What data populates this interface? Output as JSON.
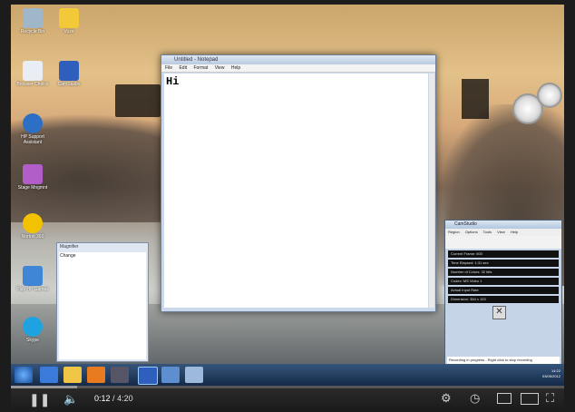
{
  "desktop": {
    "icons": [
      {
        "label": "Recycle Bin"
      },
      {
        "label": "Vuze"
      },
      {
        "label": "Browser Choice"
      },
      {
        "label": "CamStudio"
      },
      {
        "label": "HP Support Assistant"
      },
      {
        "label": "Stage Mngmnt"
      },
      {
        "label": "Norton 360"
      },
      {
        "label": "Play HP Games"
      },
      {
        "label": "Skype"
      }
    ]
  },
  "notepad": {
    "title": "Untitled - Notepad",
    "menu": [
      "File",
      "Edit",
      "Format",
      "View",
      "Help"
    ],
    "content": "Hi"
  },
  "mini_window": {
    "title": "Magnifier",
    "body": "Change"
  },
  "camstudio": {
    "title": "CamStudio",
    "menu": [
      "Region",
      "Options",
      "Tools",
      "View",
      "Help"
    ],
    "rows": [
      "Current Frame: 600",
      "Time Elapsed: 1:31 sec",
      "Number of Colors: 32 bits",
      "Codec: MS Video 1",
      "Actual Input Rate",
      "Dimension: 384 x 153"
    ],
    "status": "Recording in progress - Right click to stop recording"
  },
  "taskbar": {
    "clock_time": "14:22",
    "clock_date": "03/05/2012"
  },
  "player": {
    "current_time": "0:12",
    "duration": "4:20",
    "progress_fraction": 0.046,
    "buffered_fraction": 0.12
  },
  "colors": {
    "progress": "#cc0000",
    "taskbar": "#1f3a5f"
  }
}
